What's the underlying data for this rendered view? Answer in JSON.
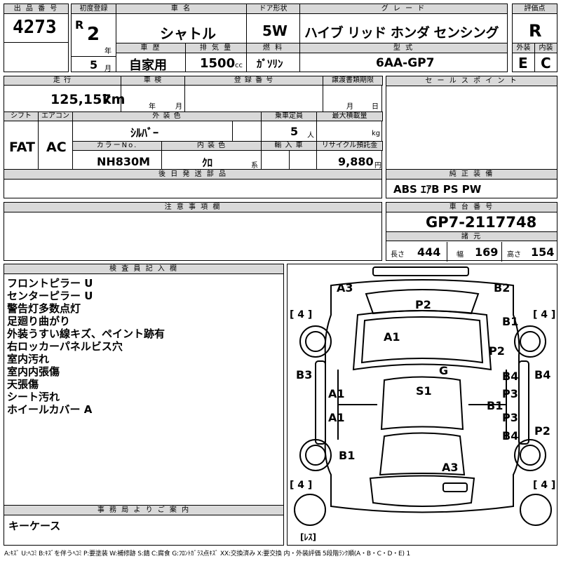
{
  "header": {
    "lot_label": "出 品 番 号",
    "lot_number": "4273",
    "first_reg_label": "初度登録",
    "era": "R",
    "year": "2",
    "year_unit": "年",
    "month": "5",
    "month_unit": "月",
    "car_name_label": "車 名",
    "car_name": "シャトル",
    "doors_label": "ドア形状",
    "doors": "5W",
    "grade_label": "グ レ ー ド",
    "grade": "ハイブ リッド ホンダ センシング",
    "score_label": "評価点",
    "score": "R",
    "history_label": "車 歴",
    "history": "自家用",
    "displacement_label": "排 気 量",
    "displacement": "1500",
    "displacement_unit": "cc",
    "fuel_label": "燃 料",
    "fuel": "ｶﾞｿﾘﾝ",
    "model_label": "型 式",
    "model": "6AA-GP7",
    "exterior_label": "外装",
    "exterior": "E",
    "interior_label": "内装",
    "interior": "C"
  },
  "mid": {
    "mileage_label": "走 行",
    "mileage": "125,157",
    "mileage_unit": "km",
    "inspection_label": "車 検",
    "inspection_year_unit": "年",
    "inspection_month_unit": "月",
    "reg_label": "登 録 番 号",
    "transfer_label": "譲渡書類期限",
    "transfer_month_unit": "月",
    "transfer_day_unit": "日",
    "sales_label": "セ ー ル ス ポ イ ン ト",
    "shift_label": "シフト",
    "shift": "FAT",
    "ac_label": "エアコン",
    "ac": "AC",
    "color_label": "外 装 色",
    "color": "ｼﾙﾊﾞｰ",
    "capacity_label": "乗車定員",
    "capacity": "5",
    "capacity_unit": "人",
    "loadcap_label": "最大積載量",
    "loadcap_unit": "kg",
    "colorno_label": "カラーNo.",
    "colorno": "NH830M",
    "intcolor_label": "内 装 色",
    "intcolor": "ｸﾛ",
    "intcolor_unit": "系",
    "import_label": "輸 入 車",
    "recycle_label": "リサイクル預託金",
    "recycle": "9,880",
    "recycle_unit": "円",
    "later_label": "後 日 発 送 部 品",
    "equip_label": "純 正 装 備",
    "equip": "ABS ｴｱB PS PW",
    "caution_label": "注 意 事 項 欄",
    "chassis_label": "車 台 番 号",
    "chassis": "GP7-2117748",
    "spec_label": "諸 元",
    "length_label": "長さ",
    "length": "444",
    "width_label": "幅",
    "width": "169",
    "height_label": "高さ",
    "height": "154"
  },
  "inspector": {
    "label": "検 査 員 記 入 欄",
    "lines": [
      "フロントピラー U",
      "センターピラー U",
      "警告灯多数点灯",
      "足廻り曲がり",
      "外装うすい線キズ、ペイント跡有",
      "右ロッカーパネルビス穴",
      "室内汚れ",
      "室内内張傷",
      "天張傷",
      "シート汚れ",
      "ホイールカバー A"
    ]
  },
  "office": {
    "label": "事 務 局 よ り ご 案 内",
    "text": "キーケース"
  },
  "diagram": {
    "marks": {
      "a3_tl": "A3",
      "b2_tr": "B2",
      "p2_top": "P2",
      "b1_rf": "B1",
      "a1_hood": "A1",
      "p2_rf": "P2",
      "g_glass": "G",
      "b3_left": "B3",
      "b4_rdoor": "B4",
      "b4_right": "B4",
      "a1_ldoor1": "A1",
      "s1_roof": "S1",
      "p3_rdoor1": "P3",
      "b1_rdoor": "B1",
      "a1_ldoor2": "A1",
      "p3_rdoor2": "P3",
      "b4_rdoor2": "B4",
      "p2_rr": "P2",
      "b1_lr": "B1",
      "a3_trunk": "A3"
    },
    "tires": [
      "[ 4 ]",
      "[ 4 ]",
      "[ 4 ]",
      "[ 4 ]"
    ],
    "spare": "[ﾚｽ]"
  },
  "legend": "A:ｷｽﾞ U:ﾍｺﾐ B:ｷｽﾞを伴うﾍｺﾐ P:要塗装 W:補修跡 S:錆 C:腐食 G:ﾌﾛﾝﾄｶﾞﾗｽ点ｷｽﾞ XX:交換済み X:要交換 内・外装評価 5段階ﾗﾝｸ順(A・B・C・D・E) 1"
}
